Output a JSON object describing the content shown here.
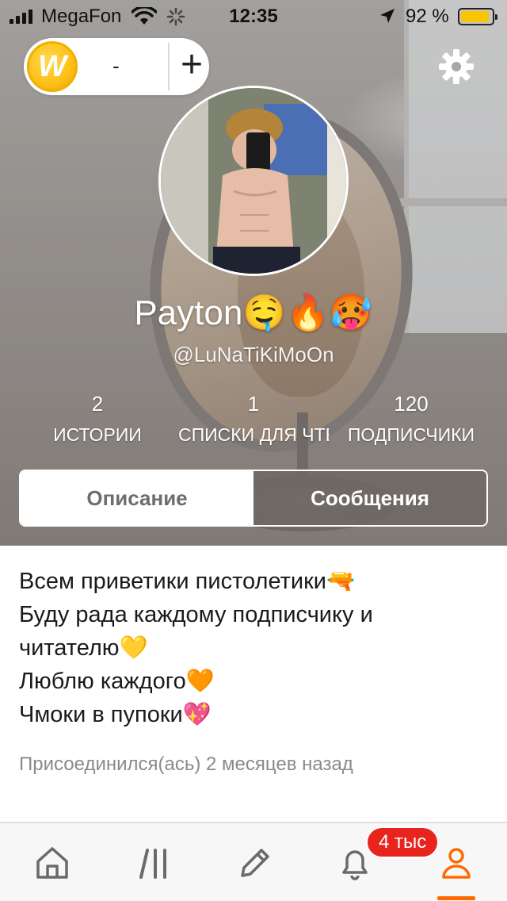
{
  "status_bar": {
    "carrier": "MegaFon",
    "time": "12:35",
    "battery_percent": "92 %",
    "battery_level": 0.92
  },
  "coins": {
    "coin_symbol": "W",
    "count": "-",
    "add_label": "+"
  },
  "profile": {
    "display_name": "Payton🤤🔥🥵",
    "username": "@LuNaTiKiMoOn",
    "stats": [
      {
        "value": "2",
        "label": "ИСТОРИИ"
      },
      {
        "value": "1",
        "label": "СПИСКИ ДЛЯ ЧТЕНИЯ"
      },
      {
        "value": "120",
        "label": "ПОДПИСЧИКИ"
      }
    ]
  },
  "tabs": {
    "description": "Описание",
    "messages": "Сообщения",
    "active": "description"
  },
  "about": {
    "lines": [
      "Всем приветики пистолетики🔫",
      "Буду рада каждому подписчику и",
      "читателю💛",
      "Люблю каждого🧡",
      "Чмоки в пупоки💖"
    ],
    "joined": "Присоединился(ась) 2 месяцев назад"
  },
  "bottom_nav": {
    "items": [
      "home-icon",
      "library-icon",
      "pencil-icon",
      "bell-icon",
      "profile-icon"
    ],
    "active": "profile",
    "notification_badge": "4 тыс"
  },
  "colors": {
    "accent": "#ff6a00",
    "badge": "#e8241d",
    "coin": "#ffc21a"
  }
}
